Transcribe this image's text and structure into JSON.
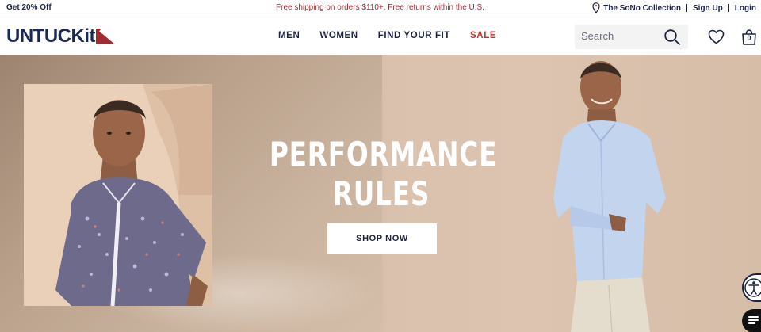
{
  "promo": {
    "left": "Get 20% Off",
    "center": "Free shipping on orders $110+. Free returns within the U.S.",
    "store_link": "The SoNo Collection",
    "signup": "Sign Up",
    "login": "Login"
  },
  "header": {
    "logo_text": "UNTUCKit",
    "nav": [
      {
        "label": "MEN"
      },
      {
        "label": "WOMEN"
      },
      {
        "label": "FIND YOUR FIT"
      },
      {
        "label": "SALE"
      }
    ],
    "search_placeholder": "Search",
    "cart_count": "0"
  },
  "hero": {
    "headline_line1": "PERFORMANCE",
    "headline_line2": "RULES",
    "cta": "SHOP NOW"
  },
  "colors": {
    "brand_navy": "#1b2a55",
    "brand_red": "#a12b33",
    "sale_red": "#c4332c",
    "hero_tan": "#d2bba6"
  },
  "icons": [
    "map-pin-icon",
    "search-icon",
    "heart-icon",
    "shopping-bag-icon",
    "accessibility-icon",
    "chat-icon"
  ]
}
